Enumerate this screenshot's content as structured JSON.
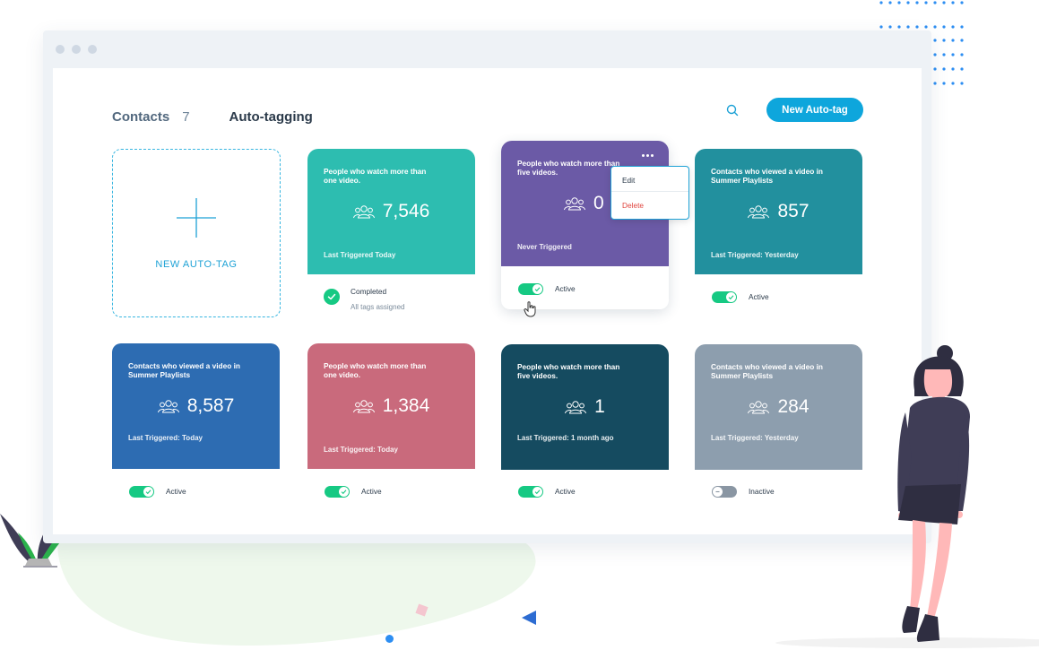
{
  "colors": {
    "accent": "#0ea6dc",
    "active_toggle": "#16c983",
    "inactive_toggle": "#8a96a3",
    "delete": "#e0453f"
  },
  "header": {
    "contacts_label": "Contacts",
    "contacts_count": "7",
    "autotagging_label": "Auto-tagging",
    "search_icon": "search-icon",
    "new_button_label": "New Auto-tag"
  },
  "new_card": {
    "label": "NEW AUTO-TAG",
    "icon": "plus-icon"
  },
  "cards": [
    {
      "title": "People who watch more than one video.",
      "count": "7,546",
      "footer": "Last Triggered Today",
      "color": "#2dbdb0",
      "status": "completed",
      "status_title": "Completed",
      "status_sub": "All tags assigned"
    },
    {
      "title": "People who watch more than five videos.",
      "count": "0",
      "footer": "Never Triggered",
      "color": "#6b5aa6",
      "status": "active",
      "status_title": "Active",
      "menu": {
        "edit_label": "Edit",
        "delete_label": "Delete",
        "more_icon": "more-horizontal-icon"
      }
    },
    {
      "title": "Contacts who viewed a video in Summer Playlists",
      "count": "857",
      "footer": "Last Triggered: Yesterday",
      "color": "#22909e",
      "status": "active",
      "status_title": "Active"
    },
    {
      "title": "Contacts who viewed a video in Summer Playlists",
      "count": "8,587",
      "footer": "Last Triggered: Today",
      "color": "#2d6cb2",
      "status": "active",
      "status_title": "Active"
    },
    {
      "title": "People who watch more than one video.",
      "count": "1,384",
      "footer": "Last Triggered: Today",
      "color": "#c96a7c",
      "status": "active",
      "status_title": "Active"
    },
    {
      "title": "People who watch more than five videos.",
      "count": "1",
      "footer": "Last Triggered: 1 month ago",
      "color": "#154b60",
      "status": "active",
      "status_title": "Active"
    },
    {
      "title": "Contacts who viewed a video in Summer Playlists",
      "count": "284",
      "footer": "Last Triggered: Yesterday",
      "color": "#8d9eae",
      "status": "inactive",
      "status_title": "Inactive"
    }
  ]
}
